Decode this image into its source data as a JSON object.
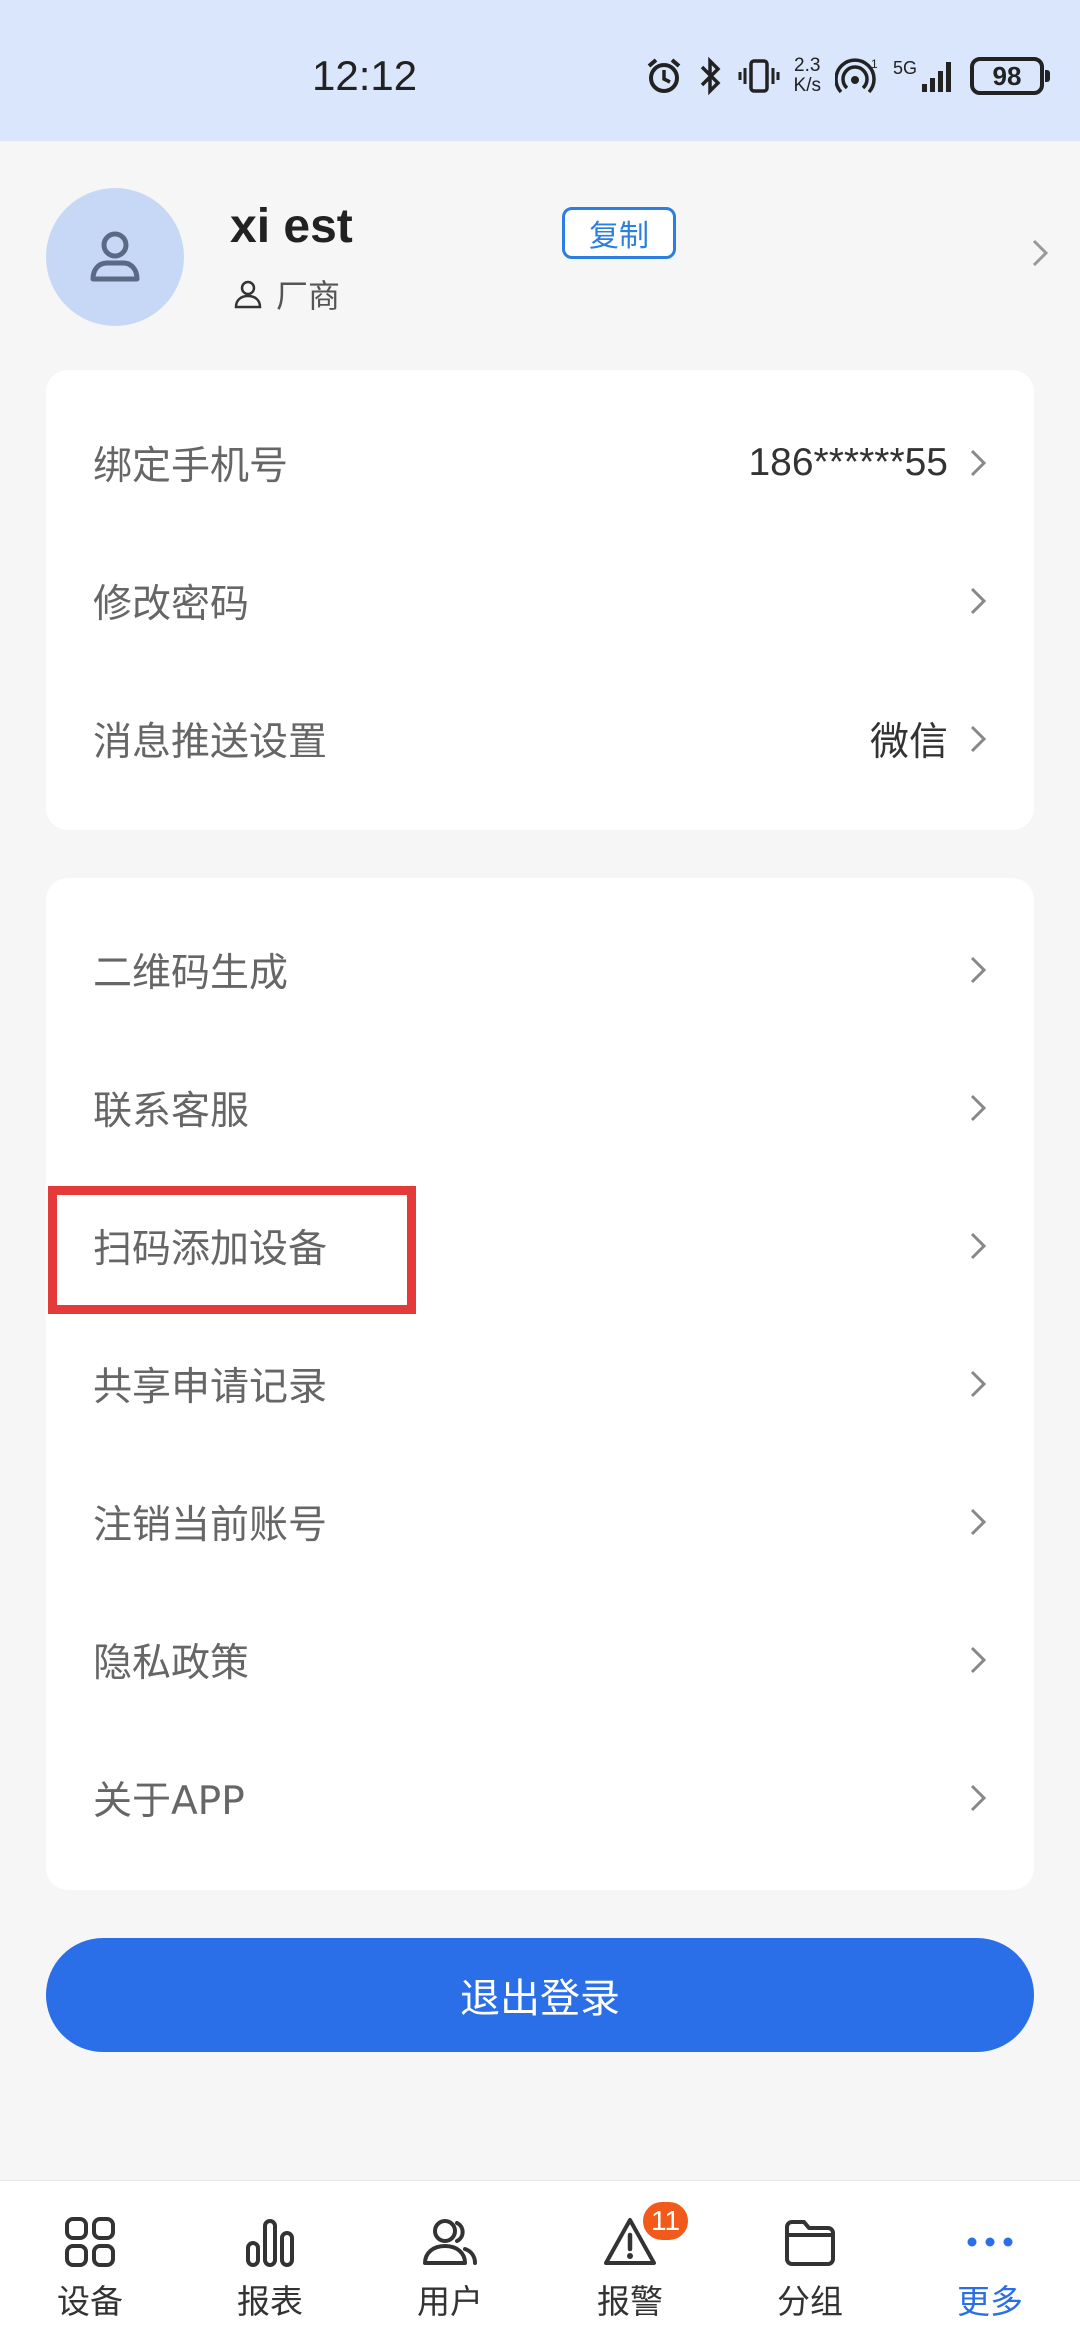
{
  "status_bar": {
    "time": "12:12",
    "net_speed_value": "2.3",
    "net_speed_unit": "K/s",
    "network": "5G",
    "battery": "98"
  },
  "profile": {
    "username": "xi        est",
    "copy_label": "复制",
    "role": "厂商"
  },
  "account_card": [
    {
      "label": "绑定手机号",
      "value": "186******55"
    },
    {
      "label": "修改密码",
      "value": ""
    },
    {
      "label": "消息推送设置",
      "value": "微信"
    }
  ],
  "menu_card": [
    {
      "label": "二维码生成"
    },
    {
      "label": "联系客服"
    },
    {
      "label": "扫码添加设备"
    },
    {
      "label": "共享申请记录"
    },
    {
      "label": "注销当前账号"
    },
    {
      "label": "隐私政策"
    },
    {
      "label": "关于APP"
    }
  ],
  "logout_label": "退出登录",
  "bottom_nav": [
    {
      "label": "设备",
      "icon": "grid-icon"
    },
    {
      "label": "报表",
      "icon": "bar-chart-icon"
    },
    {
      "label": "用户",
      "icon": "users-icon"
    },
    {
      "label": "报警",
      "icon": "warning-icon",
      "badge": "11"
    },
    {
      "label": "分组",
      "icon": "folder-icon"
    },
    {
      "label": "更多",
      "icon": "more-icon",
      "active": true
    }
  ],
  "colors": {
    "accent": "#2a6ee8",
    "status_bar_bg": "#d9e6fb",
    "highlight": "#e53a3a",
    "badge": "#f25a1b"
  }
}
